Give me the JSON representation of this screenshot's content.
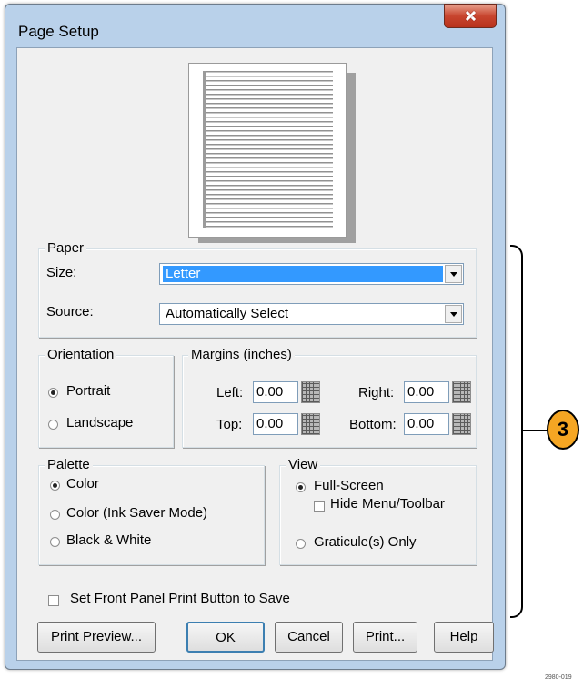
{
  "window": {
    "title": "Page Setup"
  },
  "paper": {
    "group_label": "Paper",
    "size_label": "Size:",
    "size_value": "Letter",
    "source_label": "Source:",
    "source_value": "Automatically Select"
  },
  "orientation": {
    "group_label": "Orientation",
    "portrait_label": "Portrait",
    "landscape_label": "Landscape",
    "selected": "Portrait"
  },
  "margins": {
    "group_label": "Margins (inches)",
    "left_label": "Left:",
    "left_value": "0.00",
    "right_label": "Right:",
    "right_value": "0.00",
    "top_label": "Top:",
    "top_value": "0.00",
    "bottom_label": "Bottom:",
    "bottom_value": "0.00"
  },
  "palette": {
    "group_label": "Palette",
    "color_label": "Color",
    "ink_saver_label": "Color (Ink Saver Mode)",
    "bw_label": "Black & White",
    "selected": "Color"
  },
  "view": {
    "group_label": "View",
    "full_screen_label": "Full-Screen",
    "hide_menu_label": "Hide Menu/Toolbar",
    "hide_menu_checked": false,
    "graticule_label": "Graticule(s) Only",
    "selected": "Full-Screen"
  },
  "front_panel": {
    "label": "Set Front Panel Print Button to Save",
    "checked": false
  },
  "buttons": {
    "print_preview": "Print Preview...",
    "ok": "OK",
    "cancel": "Cancel",
    "print": "Print...",
    "help": "Help"
  },
  "callout": {
    "number": "3",
    "color": "#f5a623"
  },
  "figure_id": "2980-019",
  "colors": {
    "selection": "#3399ff",
    "window_frame": "#b9d1ea",
    "close_button": "#c8452f"
  }
}
